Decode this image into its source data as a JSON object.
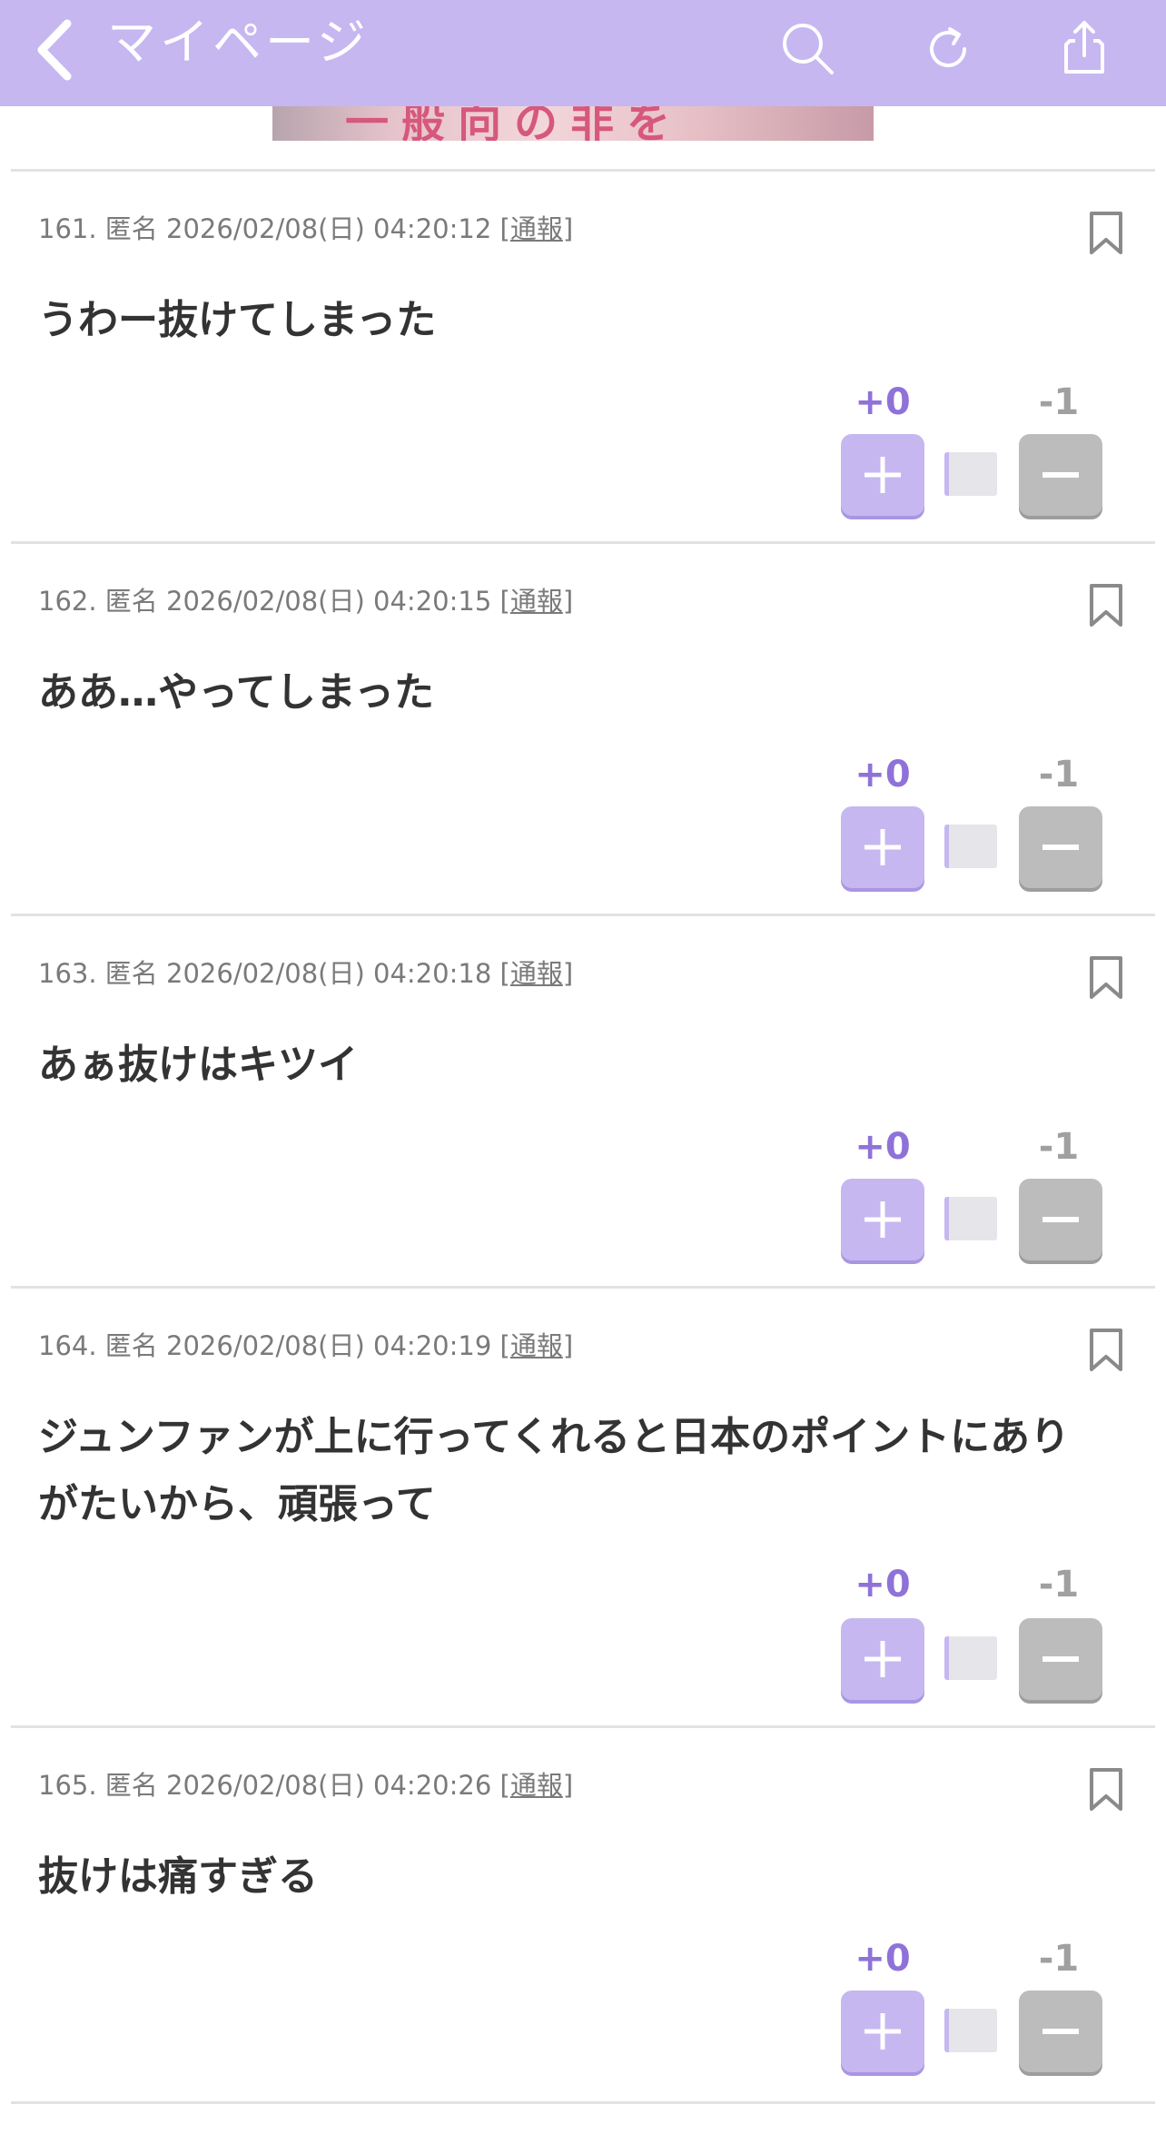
{
  "header": {
    "title": "マイページ",
    "bg_color": "#c6b7f1"
  },
  "banner": {
    "text": "一般向の非を"
  },
  "comments": [
    {
      "number": "161.",
      "author": "匿名",
      "datetime": "2026/02/08(日) 04:20:12",
      "report_open": "[",
      "report_label": "通報",
      "report_close": "]",
      "text": "うわー抜けてしまった",
      "plus_count": "+0",
      "minus_count": "-1"
    },
    {
      "number": "162.",
      "author": "匿名",
      "datetime": "2026/02/08(日) 04:20:15",
      "report_open": "[",
      "report_label": "通報",
      "report_close": "]",
      "text": "ああ…やってしまった",
      "plus_count": "+0",
      "minus_count": "-1"
    },
    {
      "number": "163.",
      "author": "匿名",
      "datetime": "2026/02/08(日) 04:20:18",
      "report_open": "[",
      "report_label": "通報",
      "report_close": "]",
      "text": "あぁ抜けはキツイ",
      "plus_count": "+0",
      "minus_count": "-1"
    },
    {
      "number": "164.",
      "author": "匿名",
      "datetime": "2026/02/08(日) 04:20:19",
      "report_open": "[",
      "report_label": "通報",
      "report_close": "]",
      "text": "ジュンファンが上に行ってくれると日本のポイントにありがたいから、頑張って",
      "plus_count": "+0",
      "minus_count": "-1"
    },
    {
      "number": "165.",
      "author": "匿名",
      "datetime": "2026/02/08(日) 04:20:26",
      "report_open": "[",
      "report_label": "通報",
      "report_close": "]",
      "text": "抜けは痛すぎる",
      "plus_count": "+0",
      "minus_count": "-1"
    }
  ],
  "icons": {
    "back": "chevron-left-icon",
    "search": "search-icon",
    "reload": "reload-icon",
    "share": "share-icon",
    "bookmark": "bookmark-icon",
    "plus": "plus-icon",
    "minus": "minus-icon"
  },
  "colors": {
    "accent": "#c6b7f1",
    "plus_text": "#8f72d9",
    "minus_bg": "#bcbcbc"
  }
}
